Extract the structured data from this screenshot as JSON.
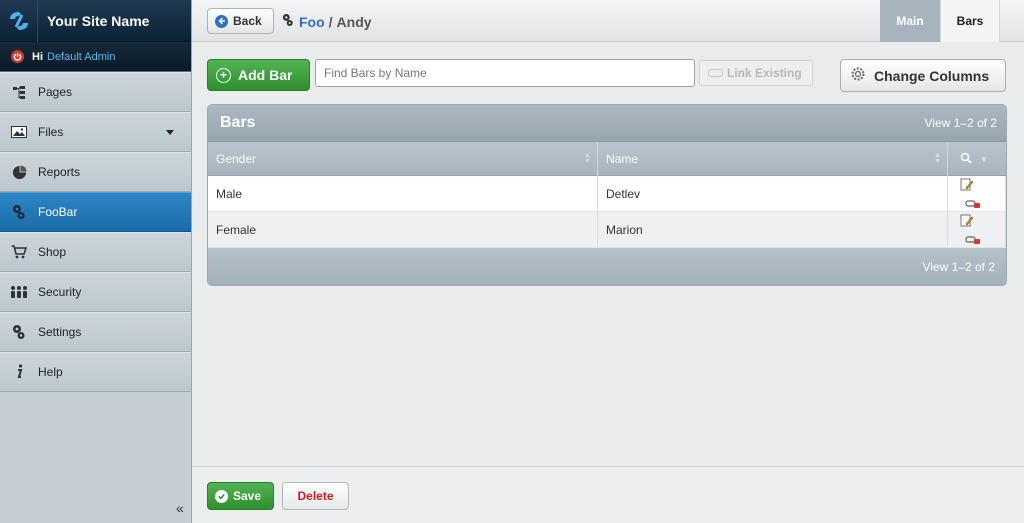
{
  "brand": {
    "site_name": "Your Site Name"
  },
  "user": {
    "greeting": "Hi",
    "name": "Default Admin"
  },
  "sidebar": {
    "items": [
      {
        "label": "Pages",
        "icon": "sitemap-icon"
      },
      {
        "label": "Files",
        "icon": "image-icon"
      },
      {
        "label": "Reports",
        "icon": "pie-chart-icon"
      },
      {
        "label": "FooBar",
        "icon": "gears-icon",
        "active": true
      },
      {
        "label": "Shop",
        "icon": "cart-icon"
      },
      {
        "label": "Security",
        "icon": "users-icon"
      },
      {
        "label": "Settings",
        "icon": "gears-icon"
      },
      {
        "label": "Help",
        "icon": "info-icon"
      }
    ],
    "collapse_label": "«"
  },
  "topbar": {
    "back_label": "Back",
    "breadcrumb": {
      "parent": "Foo",
      "separator": "/",
      "current": "Andy"
    },
    "tabs": [
      {
        "label": "Main",
        "selected": false
      },
      {
        "label": "Bars",
        "selected": true
      }
    ]
  },
  "toolbar": {
    "add_label": "Add Bar",
    "search_placeholder": "Find Bars by Name",
    "link_label": "Link Existing",
    "columns_label": "Change Columns"
  },
  "grid": {
    "title": "Bars",
    "view_count": "View 1–2 of 2",
    "columns": [
      "Gender",
      "Name"
    ],
    "rows": [
      {
        "gender": "Male",
        "name": "Detlev"
      },
      {
        "gender": "Female",
        "name": "Marion"
      }
    ],
    "footer_count": "View 1–2 of 2"
  },
  "footer": {
    "save_label": "Save",
    "delete_label": "Delete"
  },
  "colors": {
    "accent": "#1a6aa7",
    "success": "#2f8f2f",
    "danger": "#d21c1c",
    "link": "#2d6fc4",
    "header": "#a8b4bd"
  }
}
